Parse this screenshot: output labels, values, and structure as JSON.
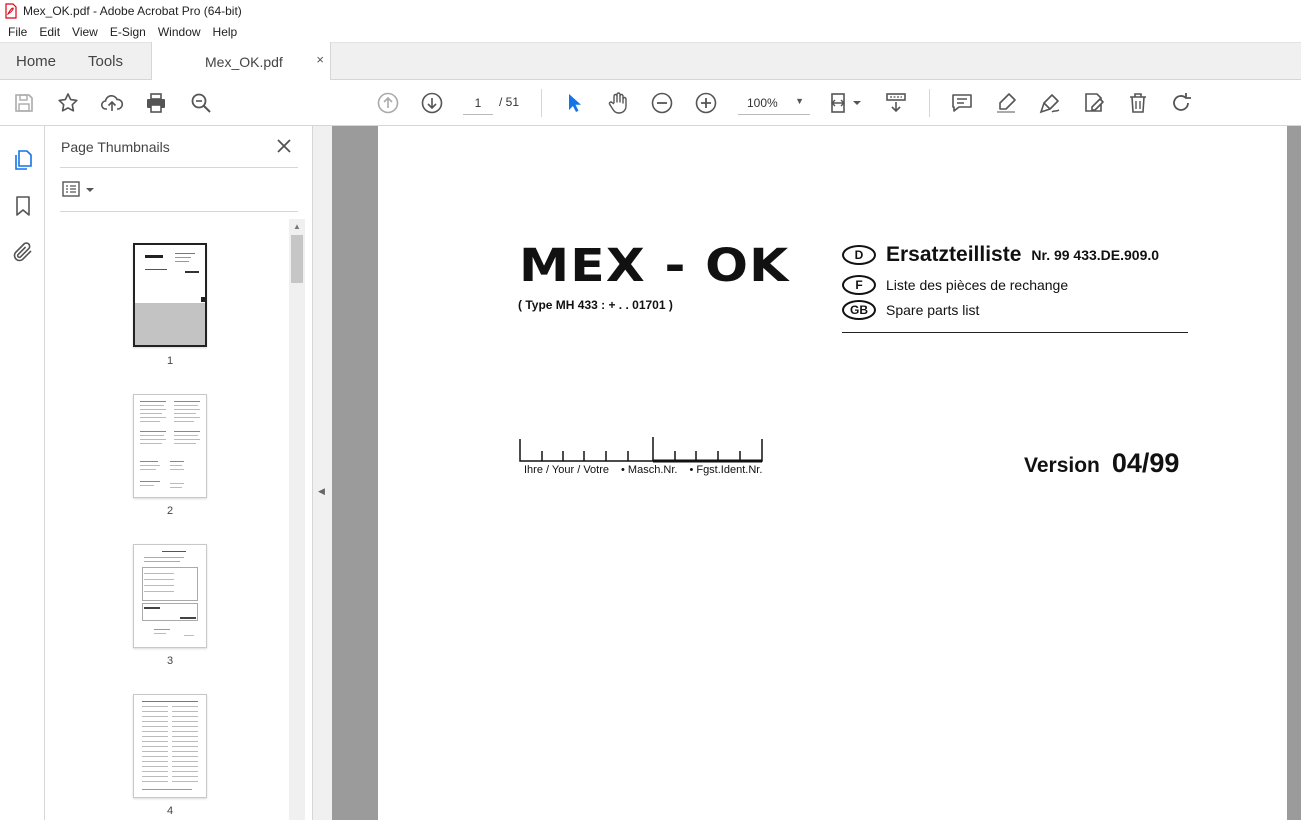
{
  "window": {
    "title": "Mex_OK.pdf - Adobe Acrobat Pro (64-bit)"
  },
  "menu": [
    "File",
    "Edit",
    "View",
    "E-Sign",
    "Window",
    "Help"
  ],
  "tabs": {
    "home": "Home",
    "tools": "Tools",
    "document": "Mex_OK.pdf",
    "close": "×"
  },
  "toolbar": {
    "current_page": "1",
    "total_pages": "/ 51",
    "zoom": "100%",
    "icons": [
      "save-icon",
      "star-icon",
      "upload-icon",
      "print-icon",
      "search-zoom-icon",
      "prev-page-icon",
      "next-page-icon",
      "select-cursor-icon",
      "hand-icon",
      "zoom-out-icon",
      "zoom-in-icon",
      "page-fit-icon",
      "scroll-mode-icon",
      "comment-icon",
      "highlight-icon",
      "sign-icon",
      "edit-icon",
      "delete-icon",
      "rotate-icon"
    ]
  },
  "left_rail": {
    "icons": [
      "page-thumbnails-icon",
      "bookmark-icon",
      "attachment-icon"
    ]
  },
  "thumbnails_panel": {
    "title": "Page Thumbnails",
    "pages": [
      "1",
      "2",
      "3",
      "4"
    ]
  },
  "document": {
    "title": "MEX - OK",
    "subtitle": "( Type MH 433 : + . . 01701 )",
    "languages": [
      {
        "code": "D",
        "text": "Ersatzteilliste",
        "nr": "Nr. 99 433.DE.909.0"
      },
      {
        "code": "F",
        "text": "Liste des pièces de rechange"
      },
      {
        "code": "GB",
        "text": "Spare parts list"
      }
    ],
    "ruler_labels": [
      "Ihre / Your / Votre",
      "• Masch.Nr.",
      "• Fgst.Ident.Nr."
    ],
    "version_label": "Version",
    "version_value": "04/99"
  }
}
